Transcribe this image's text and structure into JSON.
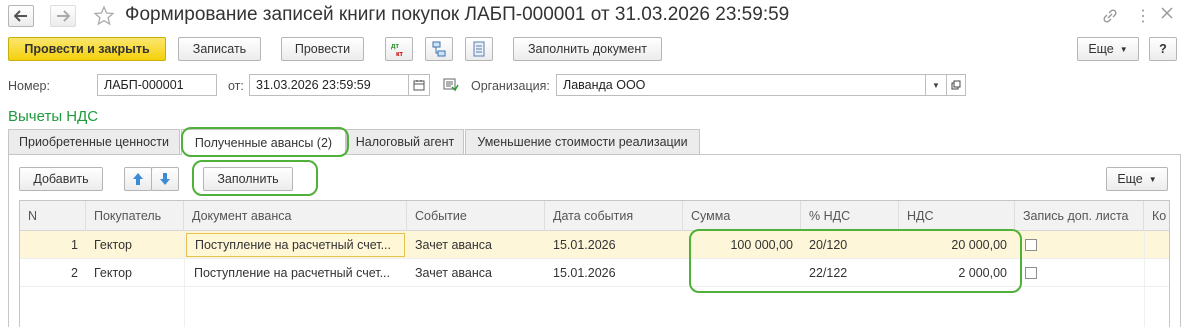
{
  "window": {
    "title": "Формирование записей книги покупок ЛАБП-000001 от 31.03.2026 23:59:59"
  },
  "toolbar": {
    "post_close": "Провести и закрыть",
    "save": "Записать",
    "post": "Провести",
    "fill_document": "Заполнить документ",
    "more": "Еще",
    "help": "?"
  },
  "header": {
    "number_label": "Номер:",
    "number_value": "ЛАБП-000001",
    "date_label": "от:",
    "date_value": "31.03.2026 23:59:59",
    "org_label": "Организация:",
    "org_value": "Лаванда ООО"
  },
  "section_title": "Вычеты НДС",
  "tabs": [
    {
      "label": "Приобретенные ценности"
    },
    {
      "label": "Полученные авансы (2)"
    },
    {
      "label": "Налоговый агент"
    },
    {
      "label": "Уменьшение стоимости реализации"
    }
  ],
  "table_toolbar": {
    "add": "Добавить",
    "fill": "Заполнить",
    "more": "Еще"
  },
  "table": {
    "columns": [
      "N",
      "Покупатель",
      "Документ аванса",
      "Событие",
      "Дата события",
      "Сумма",
      "% НДС",
      "НДС",
      "Запись доп. листа",
      "Ко"
    ],
    "rows": [
      {
        "n": "1",
        "buyer": "Гектор",
        "doc": "Поступление на расчетный счет...",
        "event": "Зачет аванса",
        "date": "15.01.2026",
        "sum": "100 000,00",
        "rate": "20/120",
        "vat": "20 000,00"
      },
      {
        "n": "2",
        "buyer": "Гектор",
        "doc": "Поступление на расчетный счет...",
        "event": "Зачет аванса",
        "date": "15.01.2026",
        "sum": "",
        "rate": "22/122",
        "vat": "2 000,00"
      }
    ]
  },
  "colors": {
    "accent_green": "#4fb139",
    "title_green": "#1e9b3c",
    "selected_row": "#fdf6d8",
    "primary_button": "#f4d10c"
  }
}
